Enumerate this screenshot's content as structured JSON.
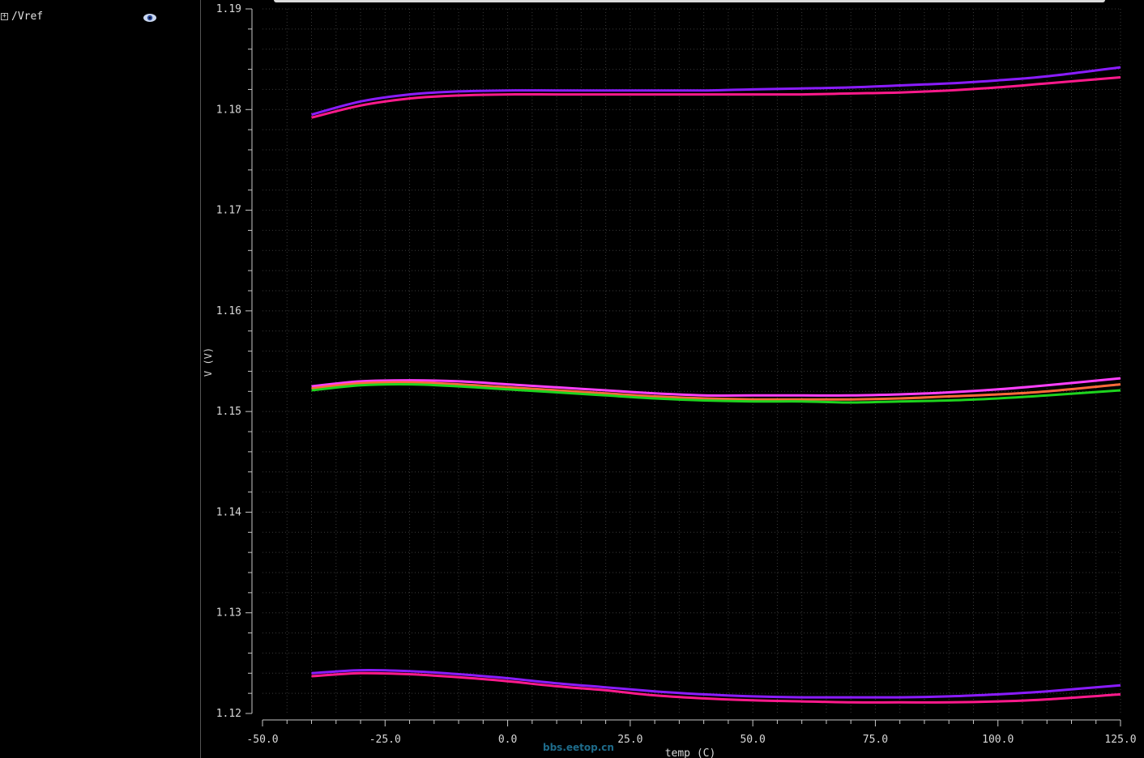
{
  "signal_panel": {
    "signal_name": "/Vref",
    "expander_symbol": "+"
  },
  "watermark": "bbs.eetop.cn",
  "colors": {
    "background": "#000000",
    "grid": "#3a3a3a",
    "axis": "#c8c8c8",
    "text": "#d8d8d8"
  },
  "chart_data": {
    "type": "line",
    "title": "",
    "xlabel": "temp (C)",
    "ylabel": "V (V)",
    "xlim": [
      -50,
      125
    ],
    "ylim": [
      1.12,
      1.19
    ],
    "x_ticks": [
      -50,
      -25,
      0,
      25,
      50,
      75,
      100,
      125
    ],
    "x_tick_labels": [
      "-50.0",
      "-25.0",
      "0.0",
      "25.0",
      "50.0",
      "75.0",
      "100.0",
      "125.0"
    ],
    "y_ticks": [
      1.12,
      1.13,
      1.14,
      1.15,
      1.16,
      1.17,
      1.18,
      1.19
    ],
    "y_tick_labels": [
      "1.12",
      "1.13",
      "1.14",
      "1.15",
      "1.16",
      "1.17",
      "1.18",
      "1.19"
    ],
    "grid": true,
    "x": [
      -40,
      -30,
      -20,
      -10,
      0,
      10,
      20,
      30,
      40,
      50,
      60,
      70,
      80,
      90,
      100,
      110,
      125
    ],
    "series": [
      {
        "color": "#8a1cff",
        "values": [
          1.1795,
          1.1808,
          1.1815,
          1.1818,
          1.1819,
          1.1819,
          1.1819,
          1.1819,
          1.1819,
          1.182,
          1.1821,
          1.1822,
          1.1824,
          1.1826,
          1.1829,
          1.1833,
          1.1842
        ]
      },
      {
        "color": "#ff1a8c",
        "values": [
          1.1792,
          1.1804,
          1.1811,
          1.1814,
          1.1815,
          1.1815,
          1.1815,
          1.1815,
          1.1815,
          1.1815,
          1.1815,
          1.1816,
          1.1817,
          1.1819,
          1.1822,
          1.1826,
          1.1832
        ]
      },
      {
        "color": "#ff40ff",
        "values": [
          1.1525,
          1.153,
          1.1531,
          1.153,
          1.1527,
          1.1524,
          1.1521,
          1.1518,
          1.1516,
          1.1516,
          1.1516,
          1.1516,
          1.1517,
          1.1519,
          1.1522,
          1.1526,
          1.1533
        ]
      },
      {
        "color": "#ff6a3a",
        "values": [
          1.1523,
          1.1528,
          1.1529,
          1.1527,
          1.1524,
          1.1521,
          1.1518,
          1.1515,
          1.1513,
          1.1512,
          1.1512,
          1.1512,
          1.1513,
          1.1515,
          1.1517,
          1.152,
          1.1527
        ]
      },
      {
        "color": "#1ed41e",
        "values": [
          1.1521,
          1.1526,
          1.1527,
          1.1525,
          1.1522,
          1.1519,
          1.1516,
          1.1513,
          1.1511,
          1.151,
          1.151,
          1.1509,
          1.151,
          1.1511,
          1.1513,
          1.1516,
          1.1521
        ]
      },
      {
        "color": "#8a1cff",
        "values": [
          1.124,
          1.1243,
          1.1242,
          1.1239,
          1.1235,
          1.123,
          1.1226,
          1.1222,
          1.1219,
          1.1217,
          1.1216,
          1.1216,
          1.1216,
          1.1217,
          1.1219,
          1.1222,
          1.1228
        ]
      },
      {
        "color": "#ff1a8c",
        "values": [
          1.1237,
          1.124,
          1.1239,
          1.1236,
          1.1232,
          1.1227,
          1.1223,
          1.1218,
          1.1215,
          1.1213,
          1.1212,
          1.1211,
          1.1211,
          1.1211,
          1.1212,
          1.1214,
          1.1219
        ]
      }
    ]
  }
}
